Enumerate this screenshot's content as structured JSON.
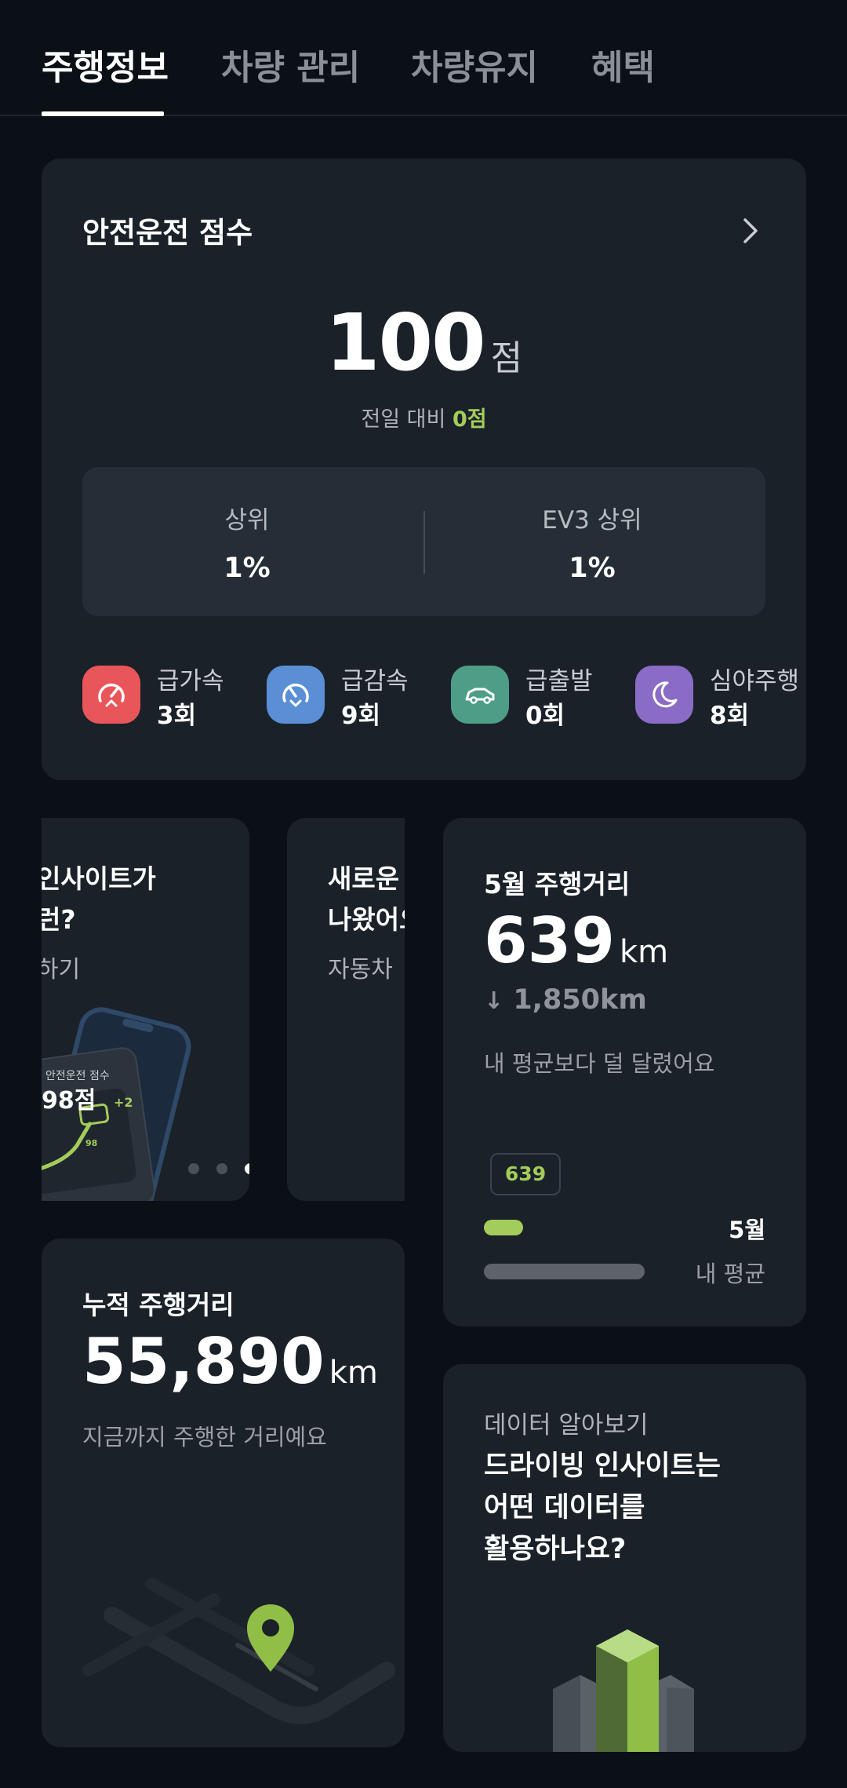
{
  "tabs": [
    {
      "label": "주행정보",
      "active": true
    },
    {
      "label": "차량 관리",
      "active": false
    },
    {
      "label": "차량유지",
      "active": false
    },
    {
      "label": "혜택",
      "active": false
    }
  ],
  "safety": {
    "title": "안전운전 점수",
    "score": "100",
    "unit": "점",
    "compare_prefix": "전일 대비",
    "compare_value": "0점",
    "rank": [
      {
        "label": "상위",
        "value": "1%"
      },
      {
        "label": "EV3 상위",
        "value": "1%"
      }
    ],
    "events": [
      {
        "label": "급가속",
        "value": "3회",
        "icon": "rapid-acceleration-icon",
        "color": "#e9565a"
      },
      {
        "label": "급감속",
        "value": "9회",
        "icon": "rapid-deceleration-icon",
        "color": "#5a8fd6"
      },
      {
        "label": "급출발",
        "value": "0회",
        "icon": "rapid-start-icon",
        "color": "#4e9e87"
      },
      {
        "label": "심야주행",
        "value": "8회",
        "icon": "moon-icon",
        "color": "#8a6cc7"
      }
    ]
  },
  "insight_carousel": {
    "card1": {
      "line1": "인사이트가",
      "line2": "런?",
      "sub": "하기"
    },
    "card2": {
      "line1": "새로운",
      "line2": "나왔어요",
      "sub": "자동차 "
    },
    "mock_label": "안전운전 점수",
    "mock_score": "98점",
    "mock_delta": "+2",
    "mock_bubble": "98",
    "pages": 3,
    "active_page": 3
  },
  "monthly": {
    "title": "5월 주행거리",
    "value": "639",
    "unit": "km",
    "diff": "1,850km",
    "desc": "내 평균보다 덜 달렸어요",
    "bar_value_label": "639",
    "bar_label_month": "5월",
    "bar_label_avg": "내 평균",
    "month_fraction": 0.14,
    "avg_fraction": 0.57
  },
  "cumulative": {
    "title": "누적 주행거리",
    "value": "55,890",
    "unit": "km",
    "desc": "지금까지 주행한 거리예요"
  },
  "data_info": {
    "sub": "데이터 알아보기",
    "title_lines": [
      "드라이빙 인사이트는",
      "어떤 데이터를",
      "활용하나요?"
    ]
  },
  "colors": {
    "accent": "#a4cc5a",
    "background": "#0a1016",
    "card": "#1a2129"
  }
}
